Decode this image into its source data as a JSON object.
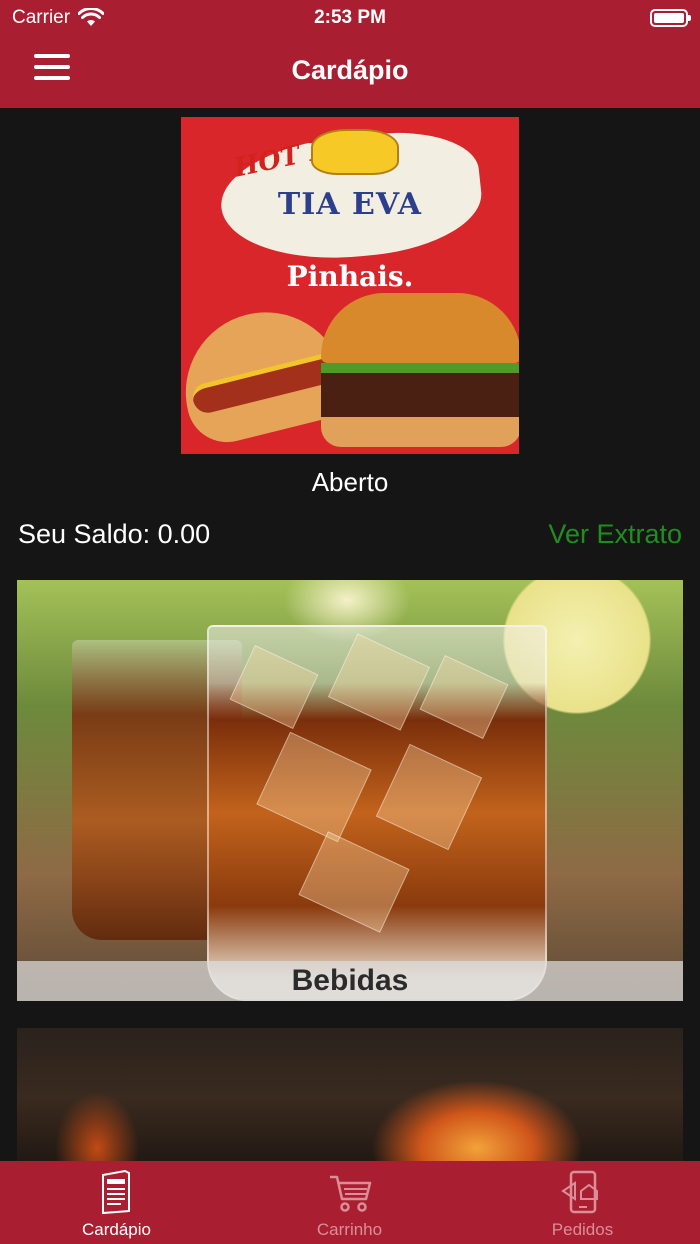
{
  "status_bar": {
    "carrier": "Carrier",
    "time": "2:53 PM"
  },
  "header": {
    "title": "Cardápio"
  },
  "store": {
    "logo_text_top": "HOT DOG",
    "logo_brand": "TIA EVA",
    "logo_sub": "Pinhais.",
    "status": "Aberto"
  },
  "balance": {
    "label": "Seu Saldo: 0.00",
    "statement_link": "Ver Extrato"
  },
  "categories": [
    {
      "label": "Bebidas"
    },
    {
      "label": ""
    }
  ],
  "tabs": [
    {
      "label": "Cardápio",
      "icon": "menu-card-icon",
      "active": true
    },
    {
      "label": "Carrinho",
      "icon": "cart-icon",
      "active": false
    },
    {
      "label": "Pedidos",
      "icon": "orders-phone-icon",
      "active": false
    }
  ],
  "colors": {
    "primary": "#a91f31",
    "background": "#151515",
    "link_green": "#1f8e1f",
    "inactive_tab": "#d98e98"
  }
}
